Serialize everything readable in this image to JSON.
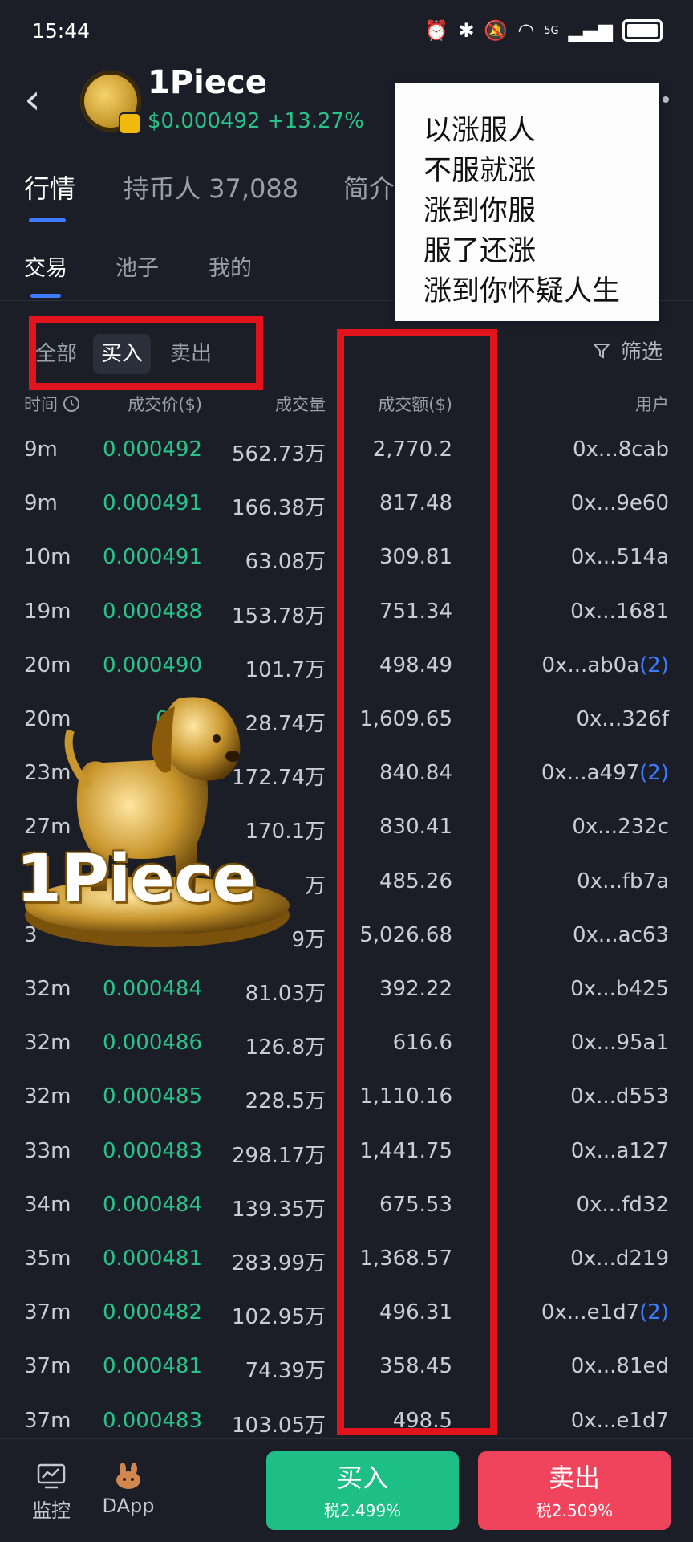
{
  "status_bar": {
    "time": "15:44",
    "network": "5G"
  },
  "header": {
    "coin_name": "1Piece",
    "price": "$0.000492",
    "change": "+13.27%"
  },
  "main_tabs": [
    {
      "label": "行情",
      "active": true
    },
    {
      "label": "持币人 37,088",
      "active": false
    },
    {
      "label": "简介",
      "active": false
    }
  ],
  "sub_tabs": [
    {
      "label": "交易",
      "active": true
    },
    {
      "label": "池子",
      "active": false
    },
    {
      "label": "我的",
      "active": false
    }
  ],
  "filter": {
    "all": "全部",
    "buy": "买入",
    "sell": "卖出",
    "screen": "筛选",
    "active": "买入"
  },
  "table": {
    "headers": {
      "time": "时间",
      "price": "成交价($)",
      "qty": "成交量",
      "amount": "成交额($)",
      "user": "用户"
    },
    "rows": [
      {
        "time": "9m",
        "price": "0.000492",
        "qty": "562.73万",
        "amount": "2,770.2",
        "user": "0x...8cab",
        "tag": ""
      },
      {
        "time": "9m",
        "price": "0.000491",
        "qty": "166.38万",
        "amount": "817.48",
        "user": "0x...9e60",
        "tag": ""
      },
      {
        "time": "10m",
        "price": "0.000491",
        "qty": "63.08万",
        "amount": "309.81",
        "user": "0x...514a",
        "tag": ""
      },
      {
        "time": "19m",
        "price": "0.000488",
        "qty": "153.78万",
        "amount": "751.34",
        "user": "0x...1681",
        "tag": ""
      },
      {
        "time": "20m",
        "price": "0.000490",
        "qty": "101.7万",
        "amount": "498.49",
        "user": "0x...ab0a",
        "tag": "(2)"
      },
      {
        "time": "20m",
        "price": "0.00",
        "qty": "28.74万",
        "amount": "1,609.65",
        "user": "0x...326f",
        "tag": ""
      },
      {
        "time": "23m",
        "price": "",
        "qty": "172.74万",
        "amount": "840.84",
        "user": "0x...a497",
        "tag": "(2)"
      },
      {
        "time": "27m",
        "price": "",
        "qty": "170.1万",
        "amount": "830.41",
        "user": "0x...232c",
        "tag": ""
      },
      {
        "time": "",
        "price": "",
        "qty": "万",
        "amount": "485.26",
        "user": "0x...fb7a",
        "tag": ""
      },
      {
        "time": "3",
        "price": "",
        "qty": "9万",
        "amount": "5,026.68",
        "user": "0x...ac63",
        "tag": ""
      },
      {
        "time": "32m",
        "price": "0.000484",
        "qty": "81.03万",
        "amount": "392.22",
        "user": "0x...b425",
        "tag": ""
      },
      {
        "time": "32m",
        "price": "0.000486",
        "qty": "126.8万",
        "amount": "616.6",
        "user": "0x...95a1",
        "tag": ""
      },
      {
        "time": "32m",
        "price": "0.000485",
        "qty": "228.5万",
        "amount": "1,110.16",
        "user": "0x...d553",
        "tag": ""
      },
      {
        "time": "33m",
        "price": "0.000483",
        "qty": "298.17万",
        "amount": "1,441.75",
        "user": "0x...a127",
        "tag": ""
      },
      {
        "time": "34m",
        "price": "0.000484",
        "qty": "139.35万",
        "amount": "675.53",
        "user": "0x...fd32",
        "tag": ""
      },
      {
        "time": "35m",
        "price": "0.000481",
        "qty": "283.99万",
        "amount": "1,368.57",
        "user": "0x...d219",
        "tag": ""
      },
      {
        "time": "37m",
        "price": "0.000482",
        "qty": "102.95万",
        "amount": "496.31",
        "user": "0x...e1d7",
        "tag": "(2)"
      },
      {
        "time": "37m",
        "price": "0.000481",
        "qty": "74.39万",
        "amount": "358.45",
        "user": "0x...81ed",
        "tag": ""
      },
      {
        "time": "37m",
        "price": "0.000483",
        "qty": "103.05万",
        "amount": "498.5",
        "user": "0x...e1d7",
        "tag": ""
      }
    ]
  },
  "note": {
    "lines": [
      "以涨服人",
      "不服就涨",
      "涨到你服",
      "服了还涨",
      "涨到你怀疑人生"
    ]
  },
  "overlay_art": {
    "text": "1Piece"
  },
  "bottom_nav": [
    {
      "label": "监控",
      "icon": "chart-monitor-icon"
    },
    {
      "label": "DApp",
      "icon": "pancake-bunny-icon"
    }
  ],
  "actions": {
    "buy": {
      "label": "买入",
      "tax": "税2.499%"
    },
    "sell": {
      "label": "卖出",
      "tax": "税2.509%"
    }
  },
  "colors": {
    "up": "#29c38a",
    "buy": "#1dbf87",
    "sell": "#f0445d",
    "accent": "#3d7cff",
    "annotation": "#e1141c"
  }
}
